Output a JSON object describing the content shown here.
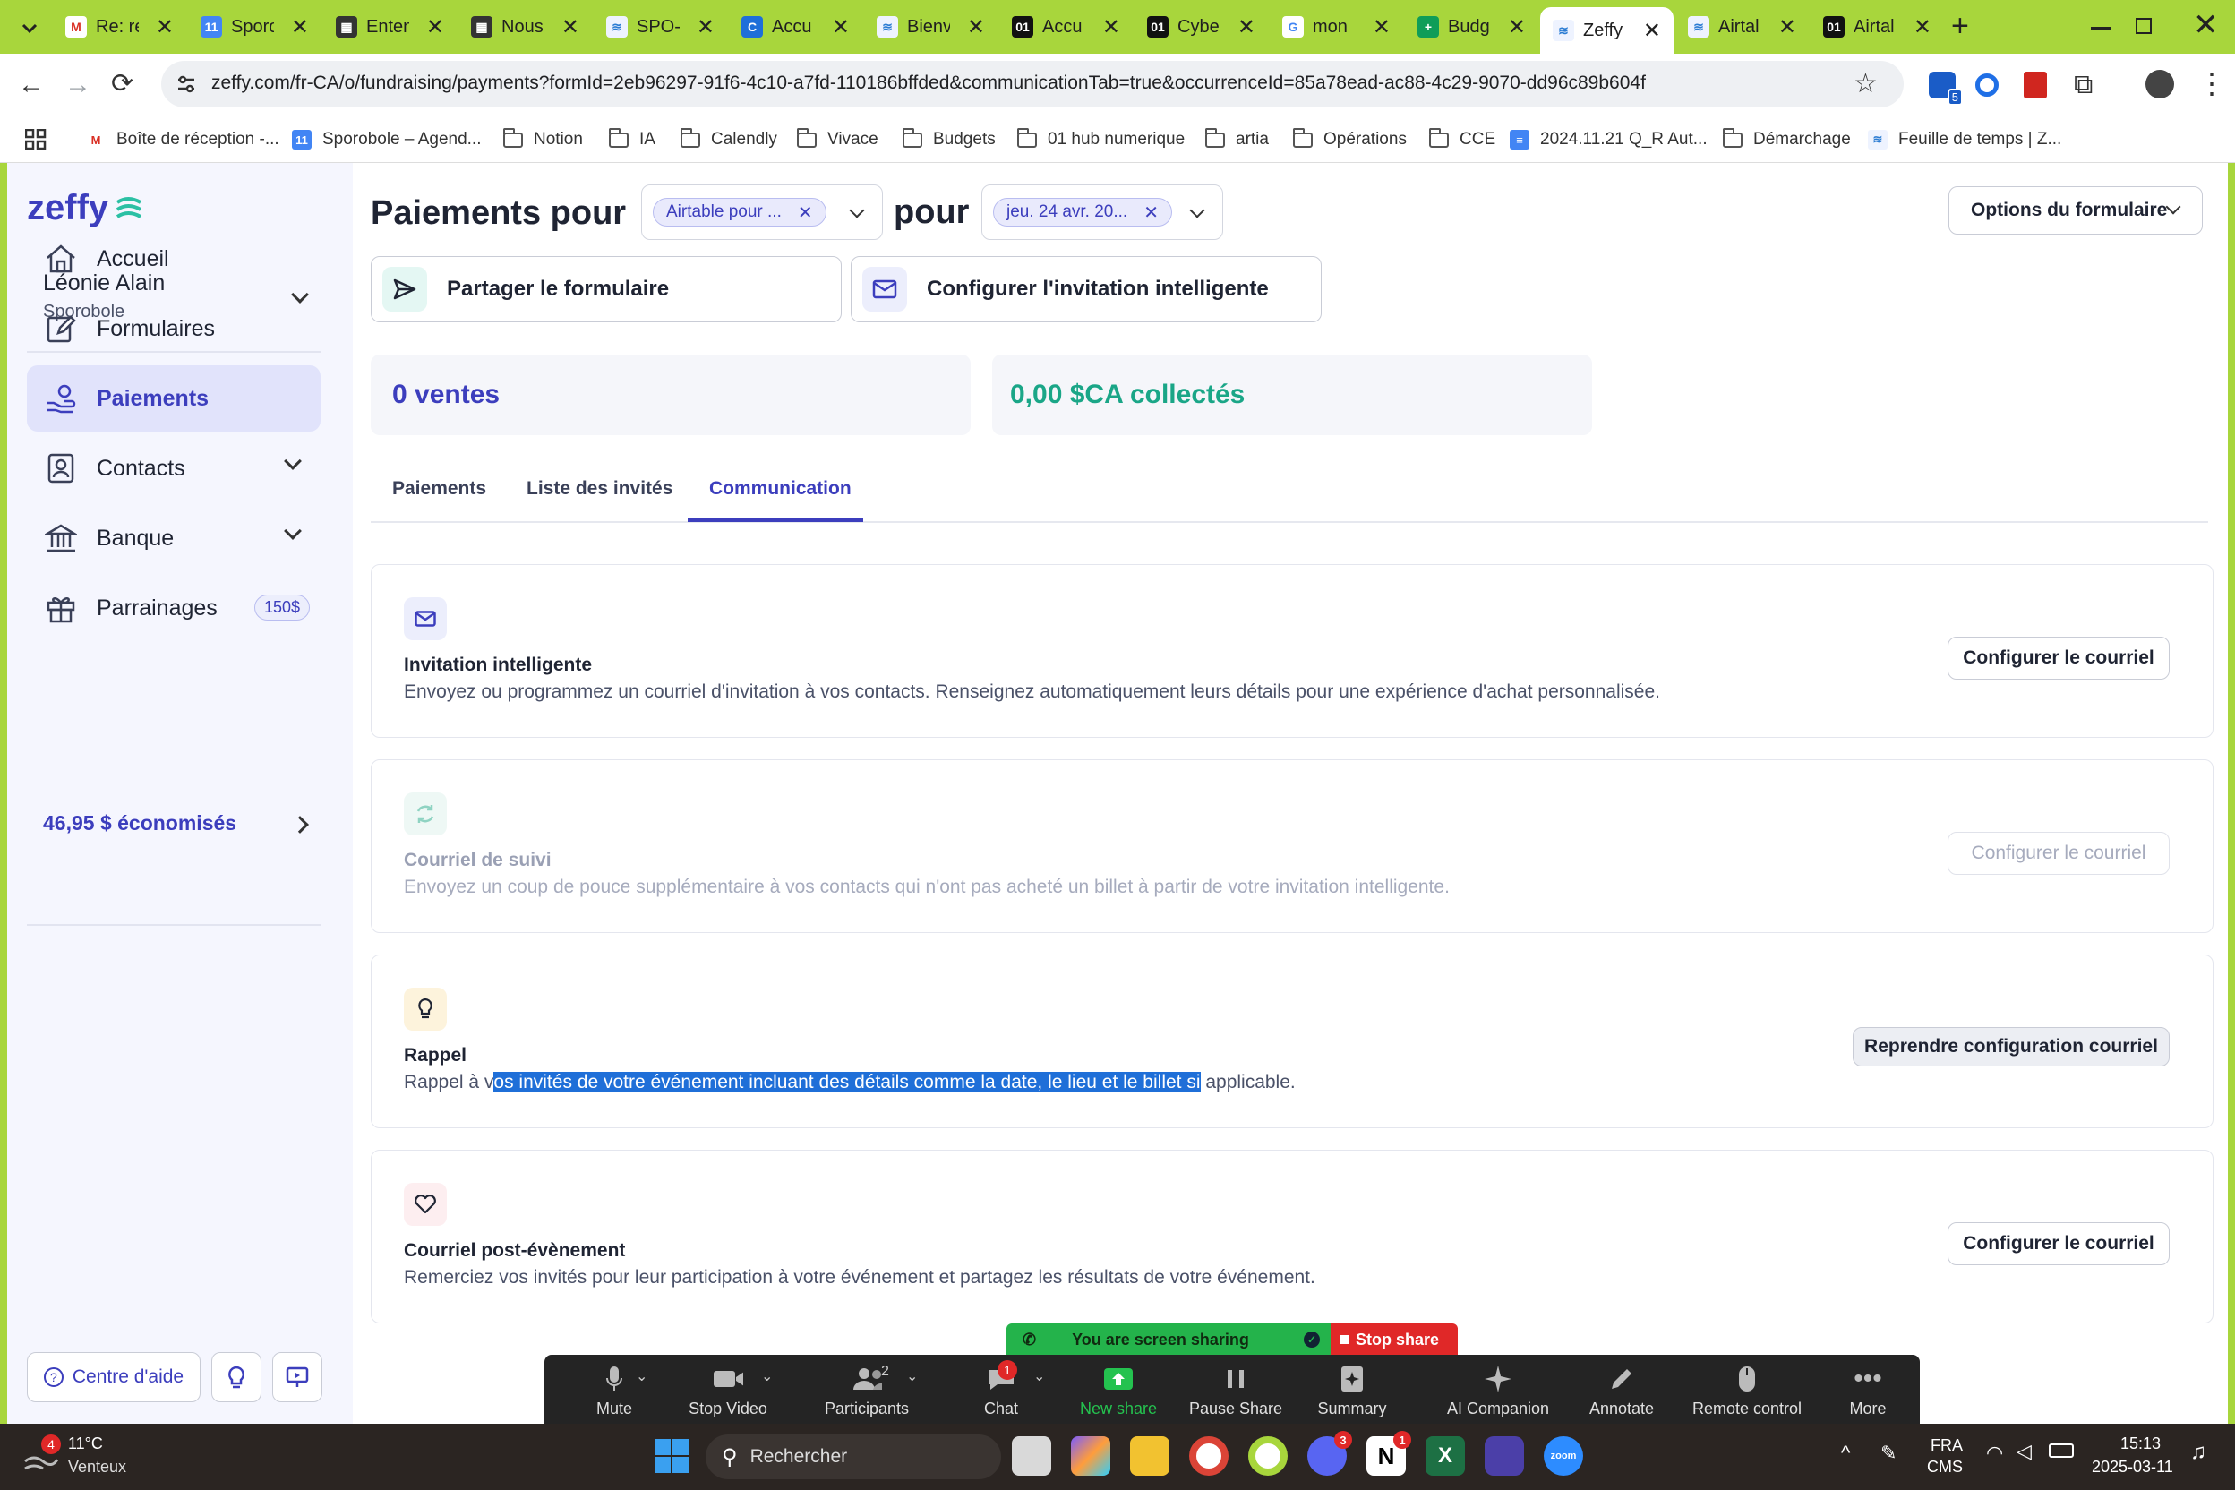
{
  "browser": {
    "tabs": [
      {
        "title": "Re: re",
        "icon": "gmail-icon"
      },
      {
        "title": "Sporo",
        "icon": "calendar-icon"
      },
      {
        "title": "Enten",
        "icon": "film-icon"
      },
      {
        "title": "Nous",
        "icon": "film-icon"
      },
      {
        "title": "SPO-(",
        "icon": "zeffy-icon"
      },
      {
        "title": "Accu",
        "icon": "c-icon"
      },
      {
        "title": "Bienv",
        "icon": "zeffy-icon"
      },
      {
        "title": "Accu",
        "icon": "01-icon"
      },
      {
        "title": "Cyber",
        "icon": "01-icon"
      },
      {
        "title": "mon",
        "icon": "google-icon"
      },
      {
        "title": "Budg",
        "icon": "sheets-icon"
      },
      {
        "title": "Zeffy",
        "icon": "zeffy-icon",
        "active": true
      },
      {
        "title": "Airtal",
        "icon": "zeffy-icon"
      },
      {
        "title": "Airtal",
        "icon": "01-icon"
      }
    ],
    "url": "zeffy.com/fr-CA/o/fundraising/payments?formId=2eb96297-91f6-4c10-a7fd-110186bffded&communicationTab=true&occurrenceId=85a78ead-ac88-4c29-9070-dd96c89b604f",
    "extension_badge": "5",
    "bookmarks": [
      "Boîte de réception -...",
      "Sporobole – Agend...",
      "Notion",
      "IA",
      "Calendly",
      "Vivace",
      "Budgets",
      "01 hub numerique",
      "artia",
      "Opérations",
      "CCE",
      "2024.11.21 Q_R Aut...",
      "Démarchage",
      "Feuille de temps | Z..."
    ]
  },
  "sidebar": {
    "logo": "zeffy",
    "user_name": "Léonie Alain",
    "org_name": "Sporobole",
    "nav": [
      {
        "label": "Accueil",
        "icon": "home-icon"
      },
      {
        "label": "Formulaires",
        "icon": "edit-icon"
      },
      {
        "label": "Paiements",
        "icon": "payment-hand-icon",
        "active": true
      },
      {
        "label": "Contacts",
        "icon": "contact-icon"
      },
      {
        "label": "Banque",
        "icon": "bank-icon"
      },
      {
        "label": "Parrainages",
        "icon": "gift-icon",
        "badge": "150$"
      }
    ],
    "savings": "46,95 $ économisés",
    "help_label": "Centre d'aide"
  },
  "header": {
    "title_prefix": "Paiements pour",
    "form_chip": "Airtable pour ...",
    "title_mid": "pour",
    "date_chip": "jeu. 24 avr. 20...",
    "options_label": "Options du formulaire",
    "share_label": "Partager le formulaire",
    "invite_label": "Configurer l'invitation intelligente"
  },
  "stats": {
    "sales": "0 ventes",
    "collected": "0,00 $CA collectés"
  },
  "tabs": {
    "items": [
      "Paiements",
      "Liste des invités",
      "Communication"
    ],
    "active": "Communication"
  },
  "cards": [
    {
      "title": "Invitation intelligente",
      "desc": "Envoyez ou programmez un courriel d'invitation à vos contacts. Renseignez automatiquement leurs détails pour une expérience d'achat personnalisée.",
      "button": "Configurer le courriel",
      "icon": "mail-icon"
    },
    {
      "title": "Courriel de suivi",
      "desc": "Envoyez un coup de pouce supplémentaire à vos contacts qui n'ont pas acheté un billet à partir de votre invitation intelligente.",
      "button": "Configurer le courriel",
      "icon": "refresh-icon",
      "disabled": true
    },
    {
      "title": "Rappel",
      "desc_before": "Rappel à v",
      "desc_selected": "os invités de votre événement incluant des détails comme la date, le lieu et le billet si",
      "desc_after": " applicable.",
      "button": "Reprendre configuration courriel",
      "icon": "lightbulb-icon"
    },
    {
      "title": "Courriel post-évènement",
      "desc": "Remerciez vos invités pour leur participation à votre événement et partagez les résultats de votre événement.",
      "button": "Configurer le courriel",
      "icon": "heart-icon"
    }
  ],
  "zoom": {
    "sharing_text": "You are screen sharing",
    "stop_share": "Stop share",
    "controls": [
      "Mute",
      "Stop Video",
      "Participants",
      "Chat",
      "New share",
      "Pause Share",
      "Summary",
      "AI Companion",
      "Annotate",
      "Remote control",
      "More"
    ],
    "participants_count": "2",
    "chat_badge": "1"
  },
  "taskbar": {
    "weather_temp": "11°C",
    "weather_desc": "Venteux",
    "weather_badge": "4",
    "search_placeholder": "Rechercher",
    "lang": "FRA",
    "lang_sub": "CMS",
    "time": "15:13",
    "date": "2025-03-11",
    "discord_badge": "3",
    "notion_badge": "1"
  }
}
